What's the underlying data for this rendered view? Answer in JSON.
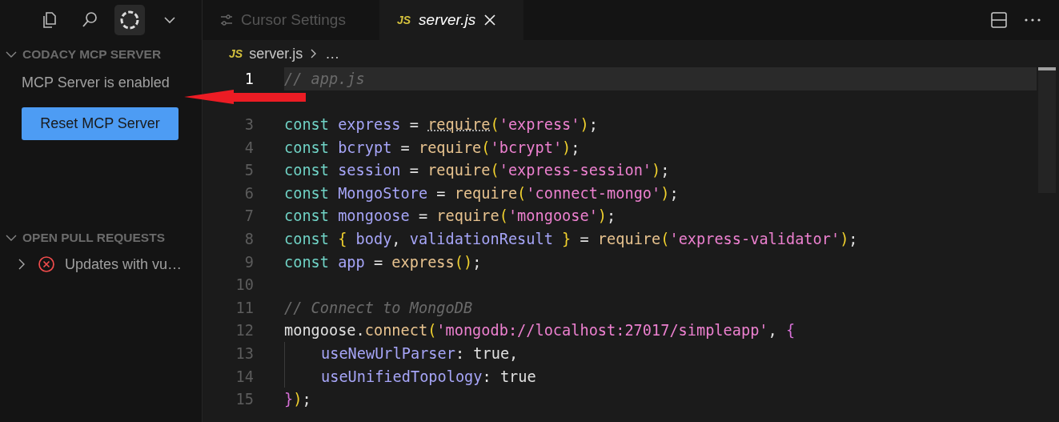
{
  "activity_bar": [
    {
      "kind": "files",
      "selected": false
    },
    {
      "kind": "search",
      "selected": false
    },
    {
      "kind": "spinner",
      "selected": true
    },
    {
      "kind": "more",
      "selected": false
    }
  ],
  "sidebar": {
    "sections": [
      {
        "title": "CODACY MCP SERVER",
        "expanded": true,
        "status": "MCP Server is enabled",
        "button": "Reset MCP Server"
      },
      {
        "title": "OPEN PULL REQUESTS",
        "expanded": true,
        "items": [
          {
            "label": "Updates with vu…",
            "expanded": false,
            "kind": "error"
          }
        ]
      }
    ]
  },
  "tabs": [
    {
      "label": "Cursor Settings",
      "kind": "settings",
      "selected": false
    },
    {
      "label": "server.js",
      "kind": "js",
      "icon_text": "JS",
      "selected": true
    }
  ],
  "breadcrumb": {
    "icon_text": "JS",
    "file": "server.js",
    "rest": "…"
  },
  "code_lines": [
    {
      "number": "1",
      "current": true,
      "tokens": [
        {
          "kind": "comment",
          "text": "// app.js"
        }
      ]
    },
    {
      "current": false
    },
    {
      "number": "3",
      "current": false,
      "tokens": [
        {
          "kind": "kw",
          "text": "const "
        },
        {
          "kind": "var",
          "text": "express"
        },
        {
          "kind": "plain",
          "text": " = "
        },
        {
          "kind": "fn",
          "text": "require",
          "hint": true
        },
        {
          "kind": "brace",
          "text": "("
        },
        {
          "kind": "str",
          "text": "'express'"
        },
        {
          "kind": "brace",
          "text": ")"
        },
        {
          "kind": "plain",
          "text": ";"
        }
      ]
    },
    {
      "number": "4",
      "current": false,
      "tokens": [
        {
          "kind": "kw",
          "text": "const "
        },
        {
          "kind": "var",
          "text": "bcrypt"
        },
        {
          "kind": "plain",
          "text": " = "
        },
        {
          "kind": "fn",
          "text": "require"
        },
        {
          "kind": "brace",
          "text": "("
        },
        {
          "kind": "str",
          "text": "'bcrypt'"
        },
        {
          "kind": "brace",
          "text": ")"
        },
        {
          "kind": "plain",
          "text": ";"
        }
      ]
    },
    {
      "number": "5",
      "current": false,
      "tokens": [
        {
          "kind": "kw",
          "text": "const "
        },
        {
          "kind": "var",
          "text": "session"
        },
        {
          "kind": "plain",
          "text": " = "
        },
        {
          "kind": "fn",
          "text": "require"
        },
        {
          "kind": "brace",
          "text": "("
        },
        {
          "kind": "str",
          "text": "'express-session'"
        },
        {
          "kind": "brace",
          "text": ")"
        },
        {
          "kind": "plain",
          "text": ";"
        }
      ]
    },
    {
      "number": "6",
      "current": false,
      "tokens": [
        {
          "kind": "kw",
          "text": "const "
        },
        {
          "kind": "var",
          "text": "MongoStore"
        },
        {
          "kind": "plain",
          "text": " = "
        },
        {
          "kind": "fn",
          "text": "require"
        },
        {
          "kind": "brace",
          "text": "("
        },
        {
          "kind": "str",
          "text": "'connect-mongo'"
        },
        {
          "kind": "brace",
          "text": ")"
        },
        {
          "kind": "plain",
          "text": ";"
        }
      ]
    },
    {
      "number": "7",
      "current": false,
      "tokens": [
        {
          "kind": "kw",
          "text": "const "
        },
        {
          "kind": "var",
          "text": "mongoose"
        },
        {
          "kind": "plain",
          "text": " = "
        },
        {
          "kind": "fn",
          "text": "require"
        },
        {
          "kind": "brace",
          "text": "("
        },
        {
          "kind": "str",
          "text": "'mongoose'"
        },
        {
          "kind": "brace",
          "text": ")"
        },
        {
          "kind": "plain",
          "text": ";"
        }
      ]
    },
    {
      "number": "8",
      "current": false,
      "tokens": [
        {
          "kind": "kw",
          "text": "const "
        },
        {
          "kind": "brace",
          "text": "{"
        },
        {
          "kind": "var",
          "text": " body"
        },
        {
          "kind": "plain",
          "text": ", "
        },
        {
          "kind": "var",
          "text": "validationResult "
        },
        {
          "kind": "brace",
          "text": "}"
        },
        {
          "kind": "plain",
          "text": " = "
        },
        {
          "kind": "fn",
          "text": "require"
        },
        {
          "kind": "brace",
          "text": "("
        },
        {
          "kind": "str",
          "text": "'express-validator'"
        },
        {
          "kind": "brace",
          "text": ")"
        },
        {
          "kind": "plain",
          "text": ";"
        }
      ]
    },
    {
      "number": "9",
      "current": false,
      "tokens": [
        {
          "kind": "kw",
          "text": "const "
        },
        {
          "kind": "var",
          "text": "app"
        },
        {
          "kind": "plain",
          "text": " = "
        },
        {
          "kind": "fn",
          "text": "express"
        },
        {
          "kind": "brace",
          "text": "()"
        },
        {
          "kind": "plain",
          "text": ";"
        }
      ]
    },
    {
      "number": "10",
      "current": false
    },
    {
      "number": "11",
      "current": false,
      "tokens": [
        {
          "kind": "comment",
          "text": "// Connect to MongoDB"
        }
      ]
    },
    {
      "number": "12",
      "current": false,
      "tokens": [
        {
          "kind": "plain",
          "text": "mongoose."
        },
        {
          "kind": "fn",
          "text": "connect"
        },
        {
          "kind": "brace",
          "text": "("
        },
        {
          "kind": "str",
          "text": "'mongodb://localhost:27017/simpleapp'"
        },
        {
          "kind": "plain",
          "text": ", "
        },
        {
          "kind": "brace2",
          "text": "{"
        }
      ]
    },
    {
      "number": "13",
      "current": false,
      "guide": true,
      "tokens": [
        {
          "kind": "prop",
          "text": "useNewUrlParser"
        },
        {
          "kind": "plain",
          "text": ": true,"
        }
      ]
    },
    {
      "number": "14",
      "current": false,
      "guide": true,
      "tokens": [
        {
          "kind": "prop",
          "text": "useUnifiedTopology"
        },
        {
          "kind": "plain",
          "text": ": true"
        }
      ]
    },
    {
      "number": "15",
      "current": false,
      "tokens": [
        {
          "kind": "brace2",
          "text": "}"
        },
        {
          "kind": "brace",
          "text": ")"
        },
        {
          "kind": "plain",
          "text": ";"
        }
      ]
    }
  ]
}
